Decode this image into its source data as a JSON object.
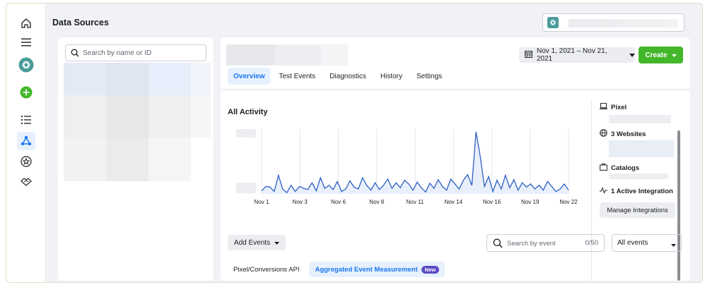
{
  "page": {
    "title": "Data Sources"
  },
  "colors": {
    "primary_blue": "#1877f2",
    "create_green": "#42b72a",
    "active_tab_bg": "#e7f0fd",
    "new_badge": "#5b4bc4"
  },
  "rail": {
    "icons": [
      "home-icon",
      "menu-icon",
      "business-avatar-icon",
      "add-icon",
      "list-icon",
      "data-sources-icon",
      "star-badge-icon",
      "partner-icon"
    ]
  },
  "list_panel": {
    "search_placeholder": "Search by name or ID"
  },
  "detail": {
    "date_range": "Nov 1, 2021 – Nov 21, 2021",
    "create_label": "Create",
    "tabs": [
      {
        "label": "Overview",
        "active": true
      },
      {
        "label": "Test Events",
        "active": false
      },
      {
        "label": "Diagnostics",
        "active": false
      },
      {
        "label": "History",
        "active": false
      },
      {
        "label": "Settings",
        "active": false
      }
    ],
    "activity_title": "All Activity",
    "info": {
      "pixel_label": "Pixel",
      "websites_label": "3 Websites",
      "catalogs_label": "Catalogs",
      "integration_label": "1 Active Integration",
      "manage_label": "Manage Integrations"
    },
    "add_events_label": "Add Events",
    "event_search_placeholder": "Search by event",
    "event_count": "0/50",
    "all_events_label": "All events",
    "subtabs": [
      {
        "label": "Pixel/Conversions API",
        "active": false
      },
      {
        "label": "Aggregated Event Measurement",
        "active": true,
        "badge": "New"
      }
    ]
  },
  "chart_data": {
    "type": "line",
    "title": "All Activity",
    "x_tick_labels": [
      "Nov 1",
      "Nov 3",
      "Nov 6",
      "Nov 8",
      "Nov 11",
      "Nov 14",
      "Nov 16",
      "Nov 19",
      "Nov 22"
    ],
    "series": [
      {
        "values": [
          5,
          12,
          11,
          4,
          30,
          8,
          2,
          14,
          4,
          12,
          9,
          7,
          18,
          5,
          26,
          9,
          14,
          7,
          20,
          4,
          8,
          21,
          11,
          8,
          26,
          14,
          6,
          18,
          7,
          14,
          24,
          9,
          18,
          10,
          22,
          16,
          6,
          19,
          10,
          3,
          17,
          9,
          23,
          12,
          6,
          24,
          16,
          8,
          22,
          31,
          14,
          100,
          60,
          12,
          28,
          4,
          22,
          8,
          30,
          10,
          23,
          6,
          18,
          11,
          16,
          8,
          14,
          6,
          20,
          12,
          4,
          8,
          16,
          6
        ]
      }
    ],
    "grid": false
  }
}
